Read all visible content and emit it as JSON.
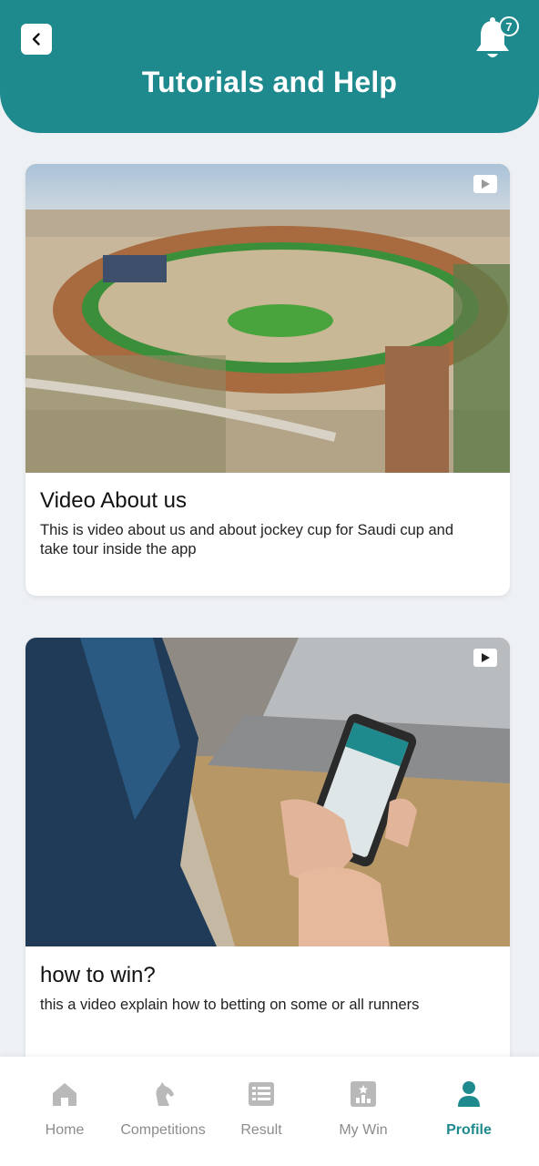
{
  "header": {
    "title": "Tutorials and Help",
    "notification_count": "7",
    "accent_color": "#1f8a8e"
  },
  "icons": {
    "back": "chevron-left-icon",
    "bell": "bell-icon",
    "play": "play-icon"
  },
  "videos": [
    {
      "title": "Video About us",
      "description": "This is video about us and about jockey cup for Saudi cup and take tour inside the app",
      "thumbnail": "aerial view of racecourse"
    },
    {
      "title": "how to win?",
      "description": "this a video explain how to betting on some or all runners",
      "thumbnail": "person holding phone with app"
    }
  ],
  "tabs": [
    {
      "label": "Home",
      "icon": "home-icon",
      "active": false
    },
    {
      "label": "Competitions",
      "icon": "horse-icon",
      "active": false
    },
    {
      "label": "Result",
      "icon": "list-icon",
      "active": false
    },
    {
      "label": "My Win",
      "icon": "trophy-board-icon",
      "active": false
    },
    {
      "label": "Profile",
      "icon": "user-icon",
      "active": true
    }
  ]
}
